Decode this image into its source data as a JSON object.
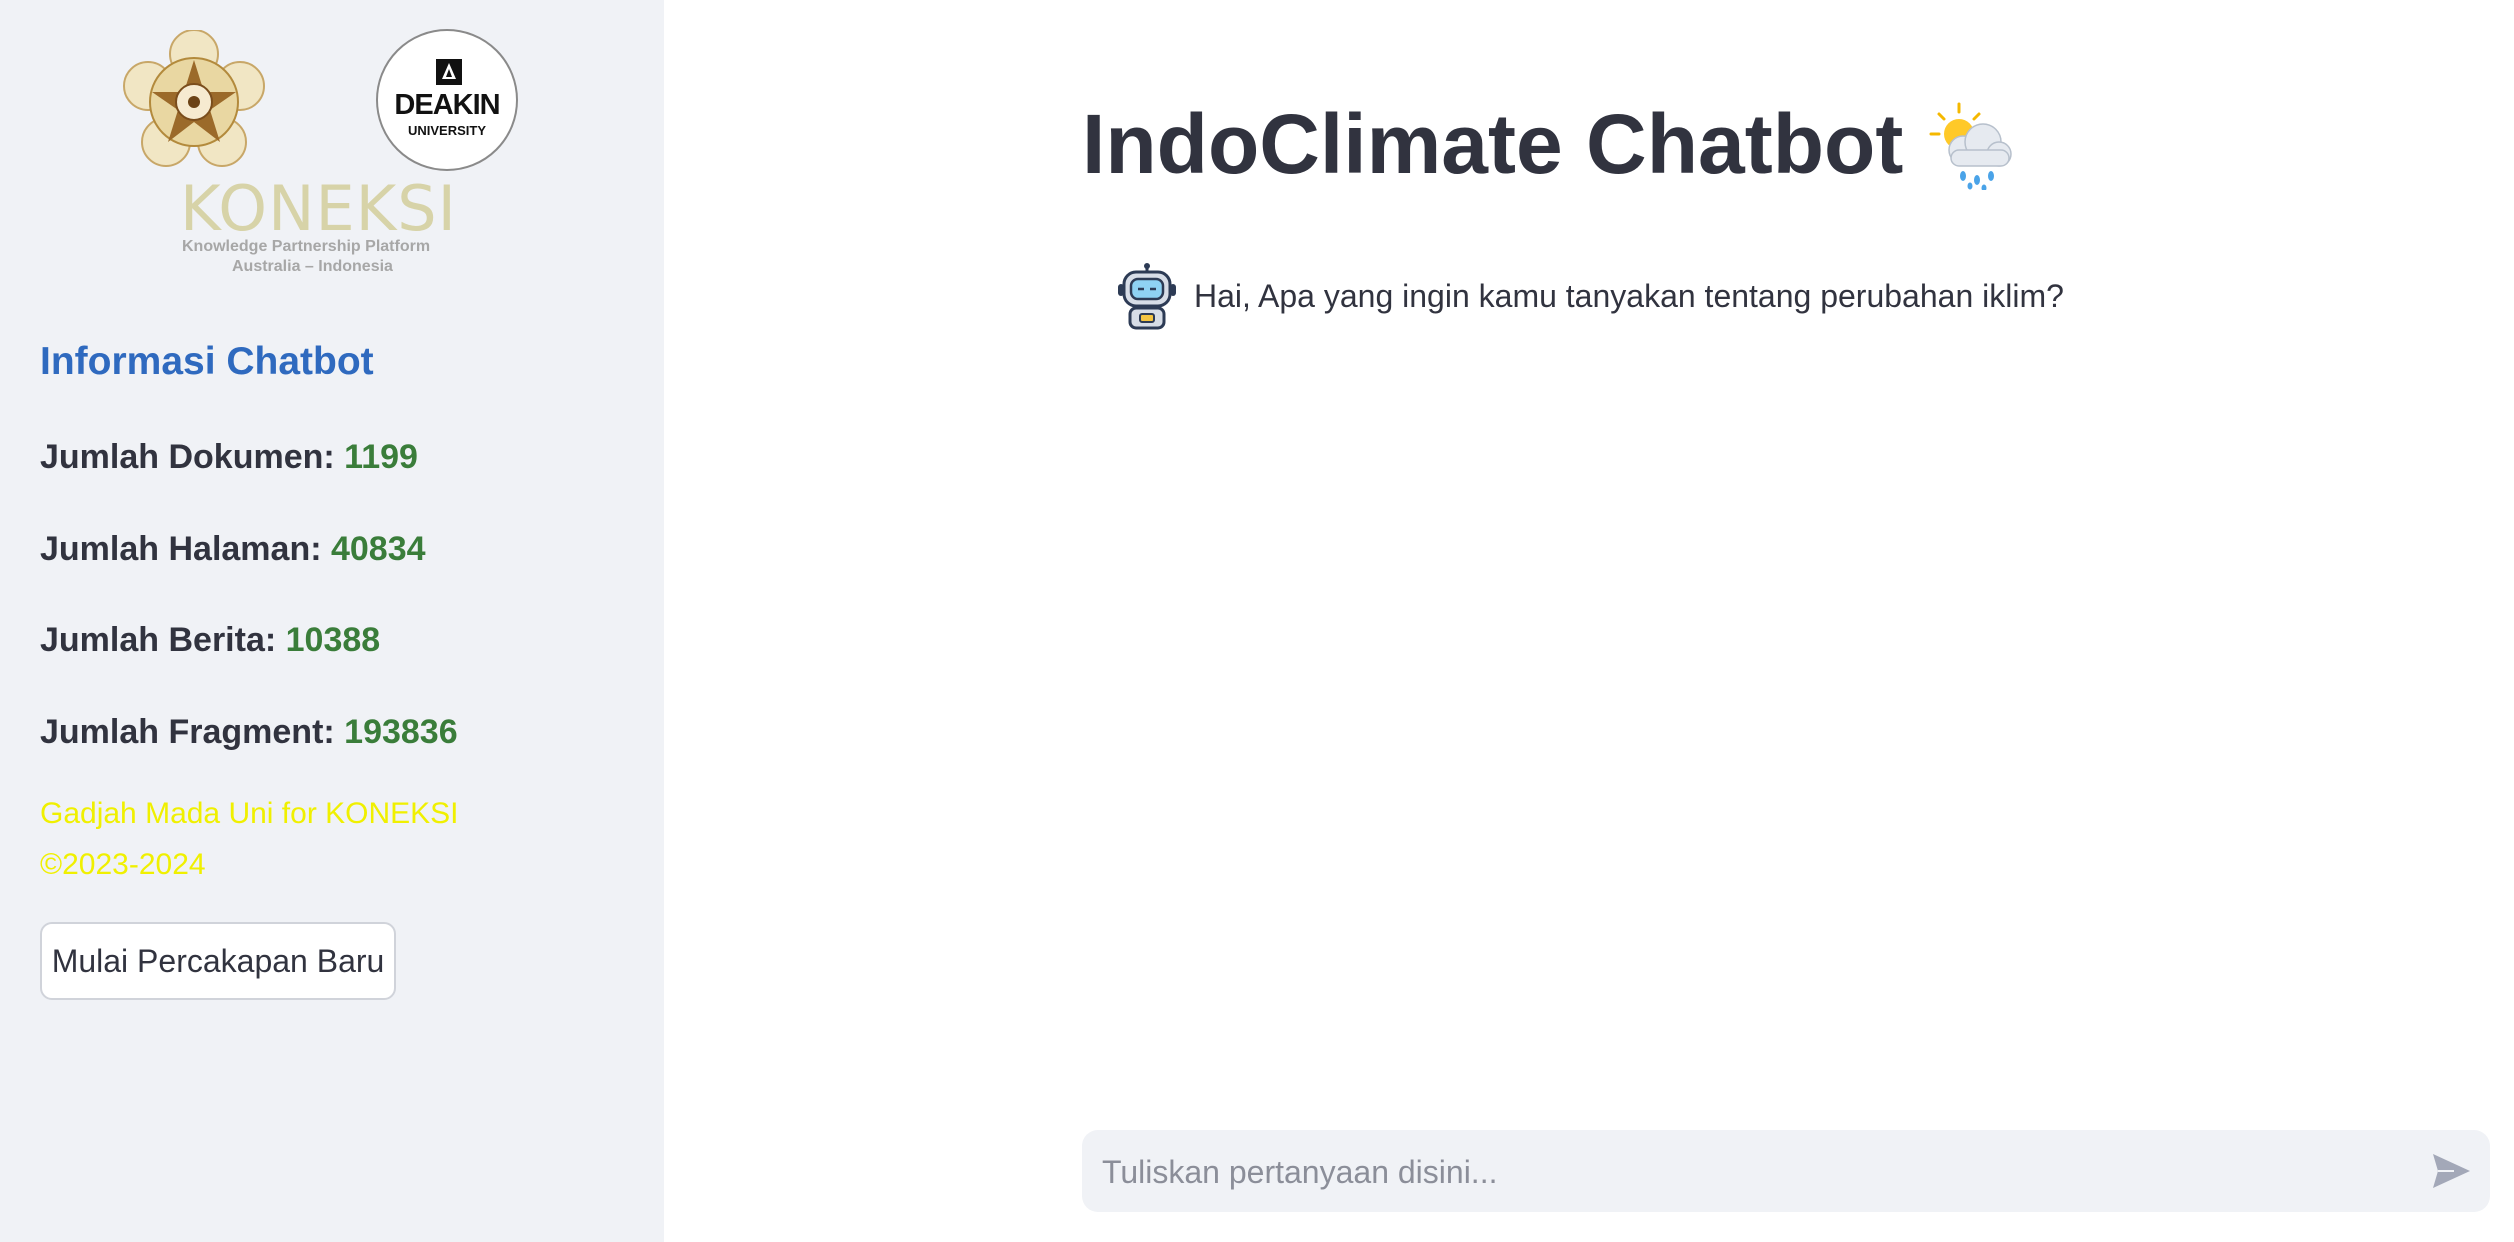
{
  "sidebar": {
    "logos": {
      "deakin_word": "DEAKIN",
      "deakin_sub": "UNIVERSITY",
      "koneksi_word": "KONEKSI",
      "koneksi_tagline": "Knowledge Partnership Platform",
      "koneksi_location": "Australia – Indonesia"
    },
    "heading": "Informasi Chatbot",
    "stats": [
      {
        "label": "Jumlah Dokumen:",
        "value": "1199"
      },
      {
        "label": "Jumlah Halaman:",
        "value": "40834"
      },
      {
        "label": "Jumlah Berita:",
        "value": "10388"
      },
      {
        "label": "Jumlah Fragment:",
        "value": "193836"
      }
    ],
    "credit_line1": "Gadjah Mada Uni for KONEKSI",
    "credit_line2": "©2023-2024",
    "new_chat_button": "Mulai Percakapan Baru"
  },
  "main": {
    "title": "IndoClimate Chatbot",
    "title_icon": "sun-behind-rain-cloud-icon",
    "messages": [
      {
        "role": "assistant",
        "avatar": "robot-icon",
        "text": "Hai, Apa yang ingin kamu tanyakan tentang perubahan iklim?"
      }
    ],
    "input": {
      "placeholder": "Tuliskan pertanyaan disini...",
      "value": "",
      "send_icon": "send-icon"
    }
  },
  "colors": {
    "sidebar_bg": "#f0f2f6",
    "heading_blue": "#2f6abf",
    "value_green": "#3a7d3a",
    "credit_yellow": "#f0f000",
    "text": "#31333f"
  }
}
